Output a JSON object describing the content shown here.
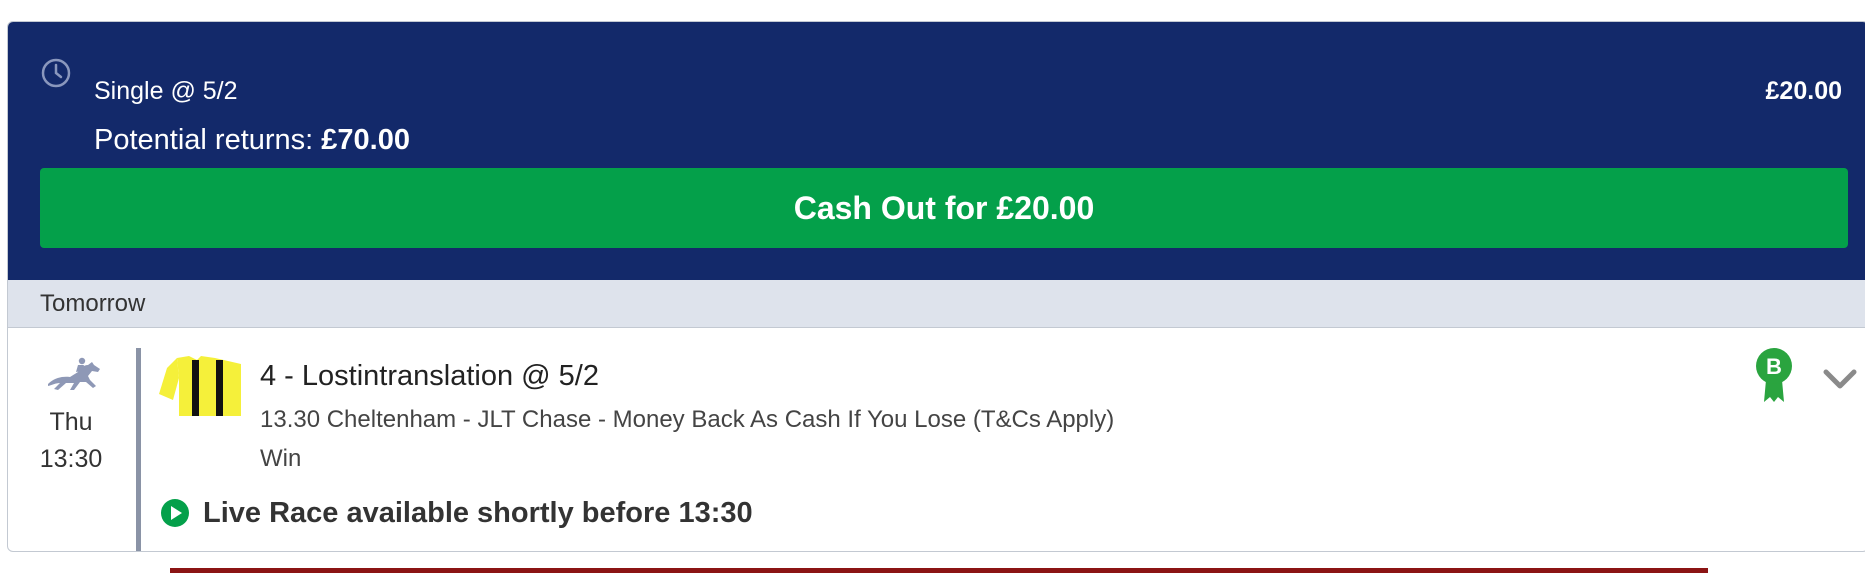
{
  "bet": {
    "type_label": "Single @ 5/2",
    "stake": "£20.00",
    "returns_label": "Potential returns:",
    "returns_value": "£70.00",
    "cashout_label": "Cash Out for £20.00"
  },
  "day_header": "Tomorrow",
  "event": {
    "day": "Thu",
    "time": "13:30",
    "selection": "4 - Lostintranslation @ 5/2",
    "market": "13.30 Cheltenham - JLT Chase - Money Back As Cash If You Lose (T&Cs Apply)",
    "bet_kind": "Win",
    "live_text": "Live Race available shortly before 13:30"
  },
  "badge_letter": "B",
  "icons": {
    "clock": "clock-icon",
    "horse": "horse-racing-icon",
    "silks": "jockey-silks-icon",
    "play": "play-icon",
    "badge": "boost-badge-icon",
    "chevron": "chevron-down-icon"
  },
  "colors": {
    "header_bg": "#13296a",
    "cashout_bg": "#04a04a",
    "day_bar_bg": "#dee3ec",
    "badge_green": "#2aa43f",
    "silks_yellow": "#f5f03a"
  }
}
